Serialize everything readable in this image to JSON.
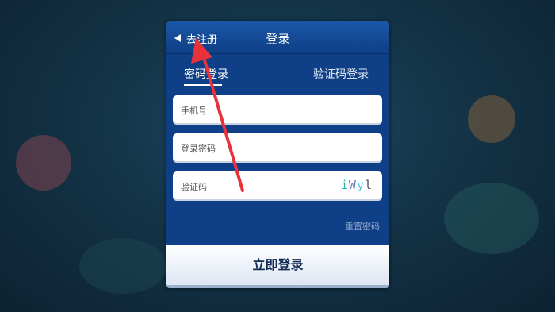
{
  "header": {
    "back_label": "去注册",
    "title": "登录"
  },
  "tabs": [
    {
      "label": "密码登录",
      "active": true
    },
    {
      "label": "验证码登录",
      "active": false
    }
  ],
  "form": {
    "phone_placeholder": "手机号",
    "password_placeholder": "登录密码",
    "captcha_placeholder": "验证码",
    "captcha_chars": [
      {
        "char": "i",
        "color": "#2bb3a8"
      },
      {
        "char": "W",
        "color": "#6b7dbf"
      },
      {
        "char": "y",
        "color": "#46c8d6"
      },
      {
        "char": "l",
        "color": "#555555"
      }
    ]
  },
  "reset_label": "重置密码",
  "login_button_label": "立即登录",
  "colors": {
    "panel": "#0f3f86",
    "annotation_arrow": "#e8333a"
  }
}
